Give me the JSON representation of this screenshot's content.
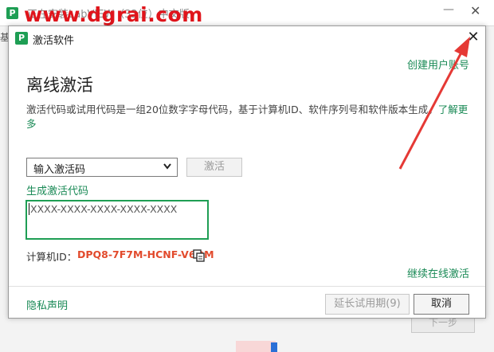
{
  "background_window": {
    "title": "正在安装LabVIEW（32位）中文版",
    "side_label": "基",
    "next_button": "下一步"
  },
  "watermark": "www.dgrai.com",
  "dialog": {
    "logo_letter": "P",
    "title": "激活软件",
    "create_account_link": "创建用户账号",
    "heading": "离线激活",
    "description": "激活代码或试用代码是一组20位数字字母代码，基于计算机ID、软件序列号和软件版本生成。",
    "learn_more_link": "了解更多",
    "code_type_select": {
      "selected": "输入激活码"
    },
    "activate_button": "激活",
    "generate_code_link": "生成激活代码",
    "code_input_placeholder": "XXXX-XXXX-XXXX-XXXX-XXXX",
    "machine_id_label": "计算机ID：",
    "machine_id_value": "DPQ8-7F7M-HCNF-V6QM",
    "continue_online_link": "继续在线激活",
    "privacy_link": "隐私声明",
    "extend_trial_button": "延长试用期(9)",
    "cancel_button": "取消"
  },
  "colors": {
    "accent_green": "#1a8a56",
    "machine_id_red": "#e24a2c",
    "watermark_red": "#e0141b",
    "arrow_red": "#e53935"
  }
}
